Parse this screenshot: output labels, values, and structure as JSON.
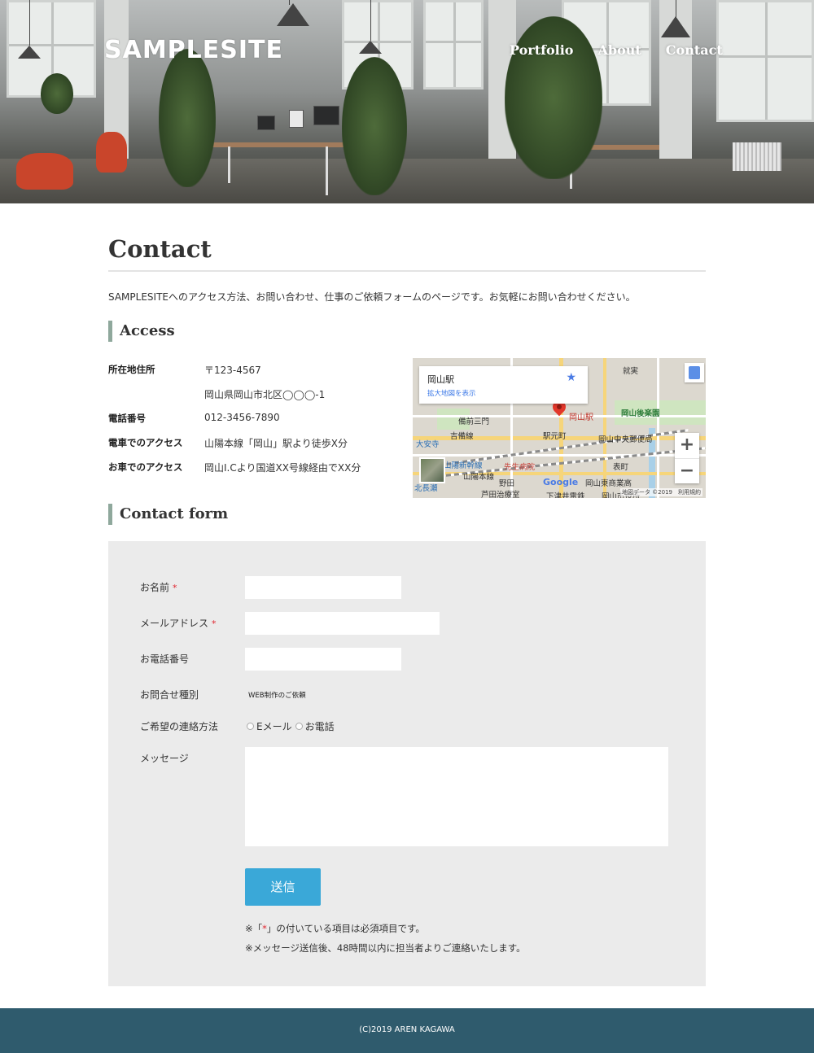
{
  "header": {
    "logo": "SAMPLESITE",
    "nav": [
      "Portfolio",
      "About",
      "Contact"
    ]
  },
  "main": {
    "title": "Contact",
    "intro": "SAMPLESITEへのアクセス方法、お問い合わせ、仕事のご依頼フォームのページです。お気軽にお問い合わせください。",
    "access": {
      "heading": "Access",
      "rows": [
        {
          "key": "所在地住所",
          "value": "〒123-4567"
        },
        {
          "key": "",
          "value": "岡山県岡山市北区◯◯◯-1"
        },
        {
          "key": "電話番号",
          "value": "012-3456-7890"
        },
        {
          "key": "電車でのアクセス",
          "value": "山陽本線「岡山」駅より徒歩X分"
        },
        {
          "key": "お車でのアクセス",
          "value": "岡山I.Cより国道XX号線経由でXX分"
        }
      ],
      "map": {
        "place_name": "岡山駅",
        "enlarge_link": "拡大地図を表示",
        "pin_label": "岡山駅",
        "zoom_in": "+",
        "zoom_out": "−",
        "google": "Google",
        "copyright": "地図データ ©2019　利用規約",
        "labels": [
          "岡山後楽園",
          "備前三門",
          "大安寺",
          "吉備線",
          "岡山中央郵便局",
          "駅元町",
          "山陽新幹線",
          "山陽本線",
          "岡山東商業高",
          "北長瀬",
          "芦田治療室",
          "野田",
          "表町",
          "下津井電鉄",
          "岡山市役所",
          "先生病院",
          "就実"
        ]
      }
    },
    "form": {
      "heading": "Contact form",
      "fields": {
        "name_label": "お名前",
        "email_label": "メールアドレス",
        "phone_label": "お電話番号",
        "inquiry_label": "お問合せ種別",
        "inquiry_value": "WEB制作のご依頼",
        "contact_method_label": "ご希望の連絡方法",
        "contact_options": [
          "Eメール",
          "お電話"
        ],
        "message_label": "メッセージ",
        "required_mark": "*"
      },
      "submit": "送信",
      "notes": {
        "note1_pre": "※「",
        "note1_mark": "*",
        "note1_post": "」の付いている項目は必須項目です。",
        "note2": "※メッセージ送信後、48時間以内に担当者よりご連絡いたします。"
      }
    }
  },
  "footer": {
    "copyright": "(C)2019 AREN KAGAWA"
  },
  "colors": {
    "accent_bar": "#8fa89c",
    "submit": "#3aa8d8",
    "footer": "#2f5b6d",
    "form_bg": "#ebebeb",
    "required": "#e0262f"
  }
}
